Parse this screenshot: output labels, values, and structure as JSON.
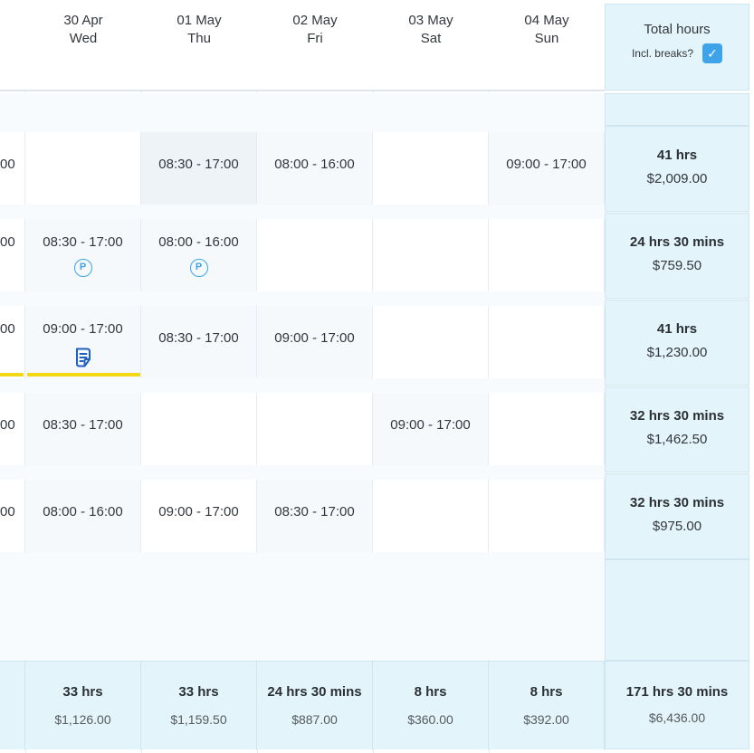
{
  "days": [
    {
      "date": "30 Apr",
      "weekday": "Wed"
    },
    {
      "date": "01 May",
      "weekday": "Thu"
    },
    {
      "date": "02 May",
      "weekday": "Fri"
    },
    {
      "date": "03 May",
      "weekday": "Sat"
    },
    {
      "date": "04 May",
      "weekday": "Sun"
    }
  ],
  "totals_header": {
    "title": "Total hours",
    "breaks_label": "Incl. breaks?",
    "breaks_checked": true
  },
  "rows": [
    {
      "partial": "00",
      "shifts": [
        "",
        "08:30 - 17:00",
        "08:00 - 16:00",
        "",
        "09:00 - 17:00"
      ],
      "total_hours": "41 hrs",
      "total_cost": "$2,009.00"
    },
    {
      "partial": "00",
      "shifts": [
        "08:30 - 17:00",
        "08:00 - 16:00",
        "",
        "",
        ""
      ],
      "icons": [
        "payroll-icon",
        "payroll-icon"
      ],
      "total_hours": "24 hrs 30 mins",
      "total_cost": "$759.50"
    },
    {
      "partial": "00",
      "shifts": [
        "09:00 - 17:00",
        "08:30 - 17:00",
        "09:00 - 17:00",
        "",
        ""
      ],
      "icons": [
        "note-icon"
      ],
      "total_hours": "41 hrs",
      "total_cost": "$1,230.00"
    },
    {
      "partial": "00",
      "shifts": [
        "08:30 - 17:00",
        "",
        "",
        "09:00 - 17:00",
        ""
      ],
      "total_hours": "32 hrs 30 mins",
      "total_cost": "$1,462.50"
    },
    {
      "partial": "00",
      "shifts": [
        "08:00 - 16:00",
        "09:00 - 17:00",
        "08:30 - 17:00",
        "",
        ""
      ],
      "total_hours": "32 hrs 30 mins",
      "total_cost": "$975.00"
    }
  ],
  "footer": [
    {
      "hours": "33 hrs",
      "cost": "$1,126.00"
    },
    {
      "hours": "33 hrs",
      "cost": "$1,159.50"
    },
    {
      "hours": "24 hrs 30 mins",
      "cost": "$887.00"
    },
    {
      "hours": "8 hrs",
      "cost": "$360.00"
    },
    {
      "hours": "8 hrs",
      "cost": "$392.00"
    }
  ],
  "grand_total": {
    "hours": "171 hrs 30 mins",
    "cost": "$6,436.00"
  },
  "icon_labels": {
    "payroll": "P"
  },
  "colors": {
    "accent": "#3fa3ea",
    "totals_bg": "#e4f4fb",
    "highlight": "#f4d816"
  }
}
